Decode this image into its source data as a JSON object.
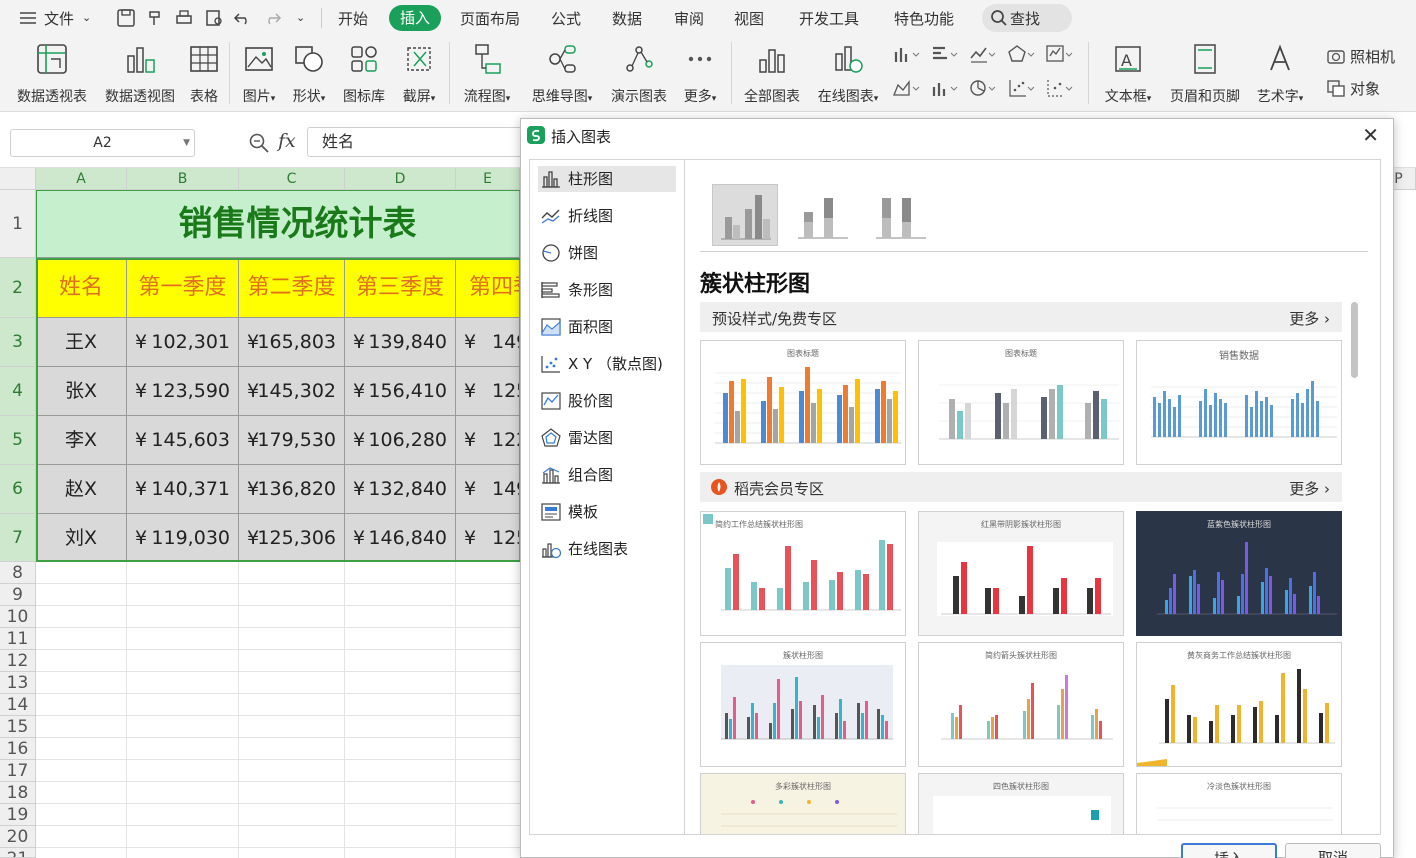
{
  "menubar": {
    "file": "文件",
    "tabs": [
      "开始",
      "插入",
      "页面布局",
      "公式",
      "数据",
      "审阅",
      "视图",
      "开发工具",
      "特色功能"
    ],
    "active_tab": "插入",
    "search": "查找"
  },
  "ribbon": {
    "pivot_table": "数据透视表",
    "pivot_chart": "数据透视图",
    "table": "表格",
    "picture": "图片",
    "shape": "形状",
    "icon_lib": "图标库",
    "screenshot": "截屏",
    "flowchart": "流程图",
    "mindmap": "思维导图",
    "presentation_chart": "演示图表",
    "more": "更多",
    "all_charts": "全部图表",
    "online_charts": "在线图表",
    "textbox": "文本框",
    "header_footer": "页眉和页脚",
    "wordart": "艺术字",
    "camera": "照相机",
    "object": "对象"
  },
  "formula_bar": {
    "cell_ref": "A2",
    "fx": "fx",
    "value": "姓名"
  },
  "sheet": {
    "columns": [
      "A",
      "B",
      "C",
      "D",
      "E",
      "P"
    ],
    "title": "销售情况统计表",
    "headers": [
      "姓名",
      "第一季度",
      "第二季度",
      "第三季度",
      "第四季"
    ],
    "rows": [
      {
        "name": "王X",
        "q1": "102,301",
        "q2": "165,803",
        "q3": "139,840",
        "q4": "149"
      },
      {
        "name": "张X",
        "q1": "123,590",
        "q2": "145,302",
        "q3": "156,410",
        "q4": "125"
      },
      {
        "name": "李X",
        "q1": "145,603",
        "q2": "179,530",
        "q3": "106,280",
        "q4": "122"
      },
      {
        "name": "赵X",
        "q1": "140,371",
        "q2": "136,820",
        "q3": "132,840",
        "q4": "149"
      },
      {
        "name": "刘X",
        "q1": "119,030",
        "q2": "125,306",
        "q3": "146,840",
        "q4": "125"
      }
    ],
    "currency": "¥",
    "row_numbers": [
      "1",
      "2",
      "3",
      "4",
      "5",
      "6",
      "7",
      "8",
      "9",
      "10",
      "11",
      "12",
      "13",
      "14",
      "15",
      "16",
      "17",
      "18",
      "19",
      "20",
      "21"
    ]
  },
  "dialog": {
    "title": "插入图表",
    "categories": [
      "柱形图",
      "折线图",
      "饼图",
      "条形图",
      "面积图",
      "X Y （散点图)",
      "股价图",
      "雷达图",
      "组合图",
      "模板",
      "在线图表"
    ],
    "selected_category": "柱形图",
    "subtype_title": "簇状柱形图",
    "section_free": "预设样式/免费专区",
    "section_member": "稻壳会员专区",
    "more": "更多",
    "free_thumbs": [
      "图表标题",
      "图表标题",
      "销售数据"
    ],
    "member_thumbs": [
      "简约工作总结簇状柱形图",
      "红黑带阴影簇状柱形图",
      "蓝紫色簇状柱形图",
      "簇状柱形图",
      "简约箭头簇状柱形图",
      "黄灰商务工作总结簇状柱形图",
      "多彩簇状柱形图",
      "四色簇状柱形图",
      "冷淡色簇状柱形图"
    ],
    "buttons": [
      "插入",
      "取消"
    ]
  },
  "colors": {
    "accent_green": "#1aa05a",
    "title_green": "#1a7a1a",
    "header_yellow": "#ffff00",
    "header_text": "#e0701e",
    "data_gray": "#d9d9d9"
  }
}
